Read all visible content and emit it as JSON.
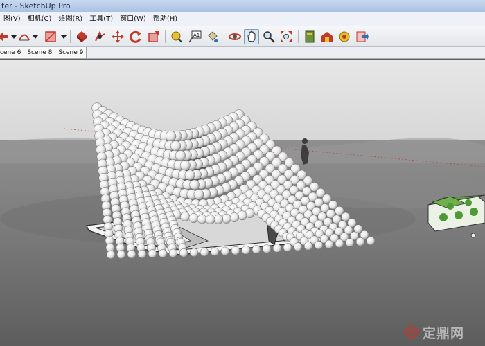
{
  "window": {
    "title": "ter - SketchUp Pro"
  },
  "menu": {
    "items": [
      "图(V)",
      "相机(C)",
      "绘图(R)",
      "工具(T)",
      "窗口(W)",
      "帮助(H)"
    ]
  },
  "toolbar": {
    "tools": [
      "select-arrow-icon",
      "arc-icon",
      "rectangle-icon",
      "push-pull-icon",
      "follow-me-icon",
      "move-icon",
      "rotate-icon",
      "scale-icon",
      "tape-measure-icon",
      "text-icon",
      "paint-bucket-icon",
      "orbit-icon",
      "pan-icon",
      "zoom-icon",
      "zoom-extents-icon",
      "components-icon",
      "warehouse-icon",
      "extension-icon",
      "export-icon"
    ],
    "active_tool": "pan-icon"
  },
  "scenes": {
    "tabs": [
      "cene 6",
      "Scene 8",
      "Scene 9"
    ]
  },
  "watermark": {
    "text": "定鼎网",
    "brand_color": "#c0392b"
  }
}
